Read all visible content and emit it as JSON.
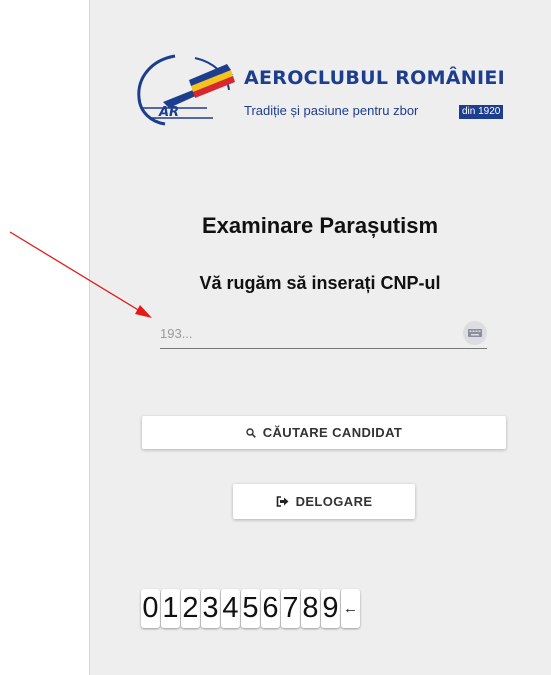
{
  "brand": {
    "name": "AEROCLUBUL ROMÂNIEI",
    "tagline": "Tradiție și pasiune pentru zbor",
    "year_badge": "din 1920",
    "logo_initials": "AR",
    "colors": {
      "primary": "#1d3d8f",
      "flag_blue": "#1d3d8f",
      "flag_yellow": "#f6c21b",
      "flag_red": "#d7282f"
    }
  },
  "page": {
    "title": "Examinare Parașutism",
    "subtitle": "Vă rugăm să inserați CNP-ul"
  },
  "cnp_input": {
    "value": "",
    "placeholder": "193...",
    "keyboard_icon": "keyboard-icon"
  },
  "buttons": {
    "search": {
      "label": "CĂUTARE CANDIDAT",
      "icon": "search-icon"
    },
    "logout": {
      "label": "DELOGARE",
      "icon": "logout-icon"
    }
  },
  "keypad": {
    "digits": [
      "0",
      "1",
      "2",
      "3",
      "4",
      "5",
      "6",
      "7",
      "8",
      "9"
    ],
    "backspace": "←"
  },
  "annotation": {
    "arrow_color": "#e41a1a"
  }
}
